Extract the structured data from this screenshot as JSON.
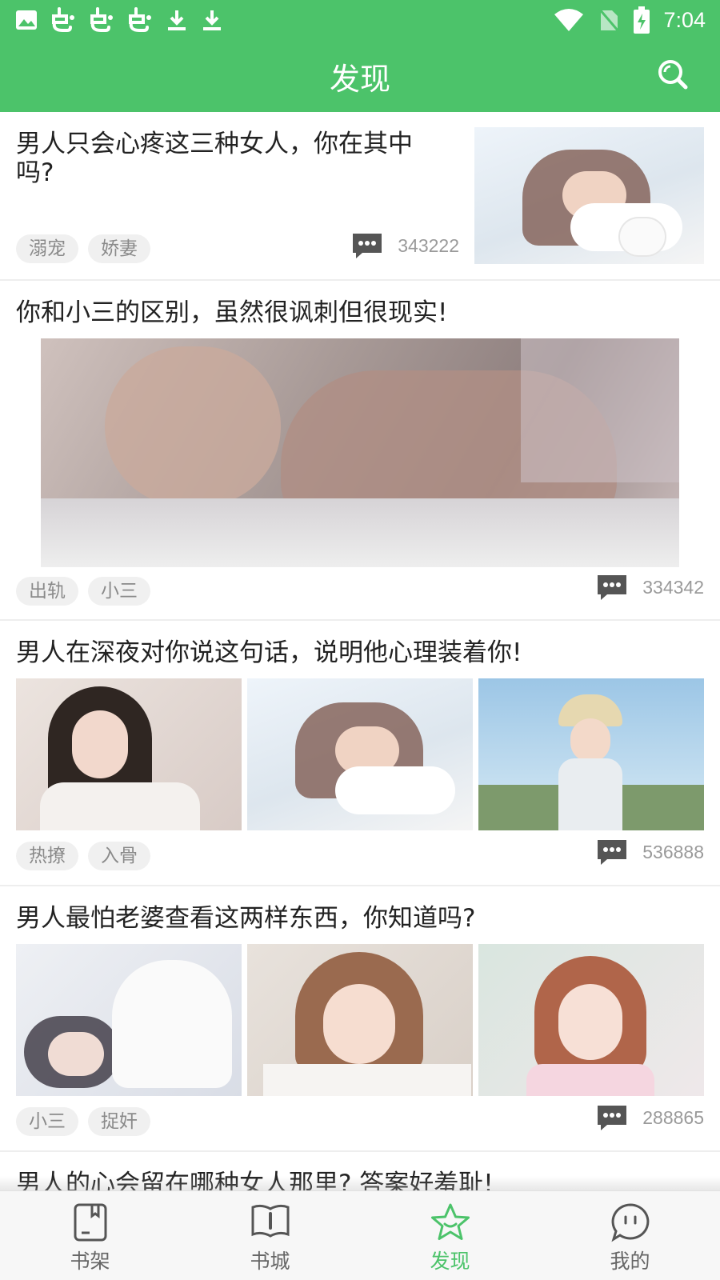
{
  "status_bar": {
    "time": "7:04",
    "left_icons": [
      "image-icon",
      "app-icon",
      "app-icon",
      "app-icon",
      "download-icon",
      "download-icon"
    ],
    "right_icons": [
      "wifi-icon",
      "no-sim-icon",
      "battery-charging-icon"
    ]
  },
  "header": {
    "title": "发现",
    "search_icon": "search-icon"
  },
  "feed": [
    {
      "title": "男人只会心疼这三种女人，你在其中吗?",
      "tags": [
        "溺宠",
        "娇妻"
      ],
      "comments": "343222"
    },
    {
      "title": "你和小三的区别，虽然很讽刺但很现实!",
      "tags": [
        "出轨",
        "小三"
      ],
      "comments": "334342"
    },
    {
      "title": "男人在深夜对你说这句话，说明他心理装着你!",
      "tags": [
        "热撩",
        "入骨"
      ],
      "comments": "536888"
    },
    {
      "title": "男人最怕老婆查看这两样东西，你知道吗?",
      "tags": [
        "小三",
        "捉奸"
      ],
      "comments": "288865"
    },
    {
      "title": "男人的心会留在哪种女人那里? 答案好羞耻!"
    }
  ],
  "bottom_nav": [
    {
      "label": "书架",
      "icon": "bookshelf-icon"
    },
    {
      "label": "书城",
      "icon": "book-open-icon"
    },
    {
      "label": "发现",
      "icon": "star-icon",
      "active": true
    },
    {
      "label": "我的",
      "icon": "chat-bubble-icon"
    }
  ],
  "colors": {
    "accent": "#4cc36a",
    "tag_bg": "#f0f0f0",
    "tag_text": "#8a8a8a",
    "nav_inactive": "#666666"
  }
}
